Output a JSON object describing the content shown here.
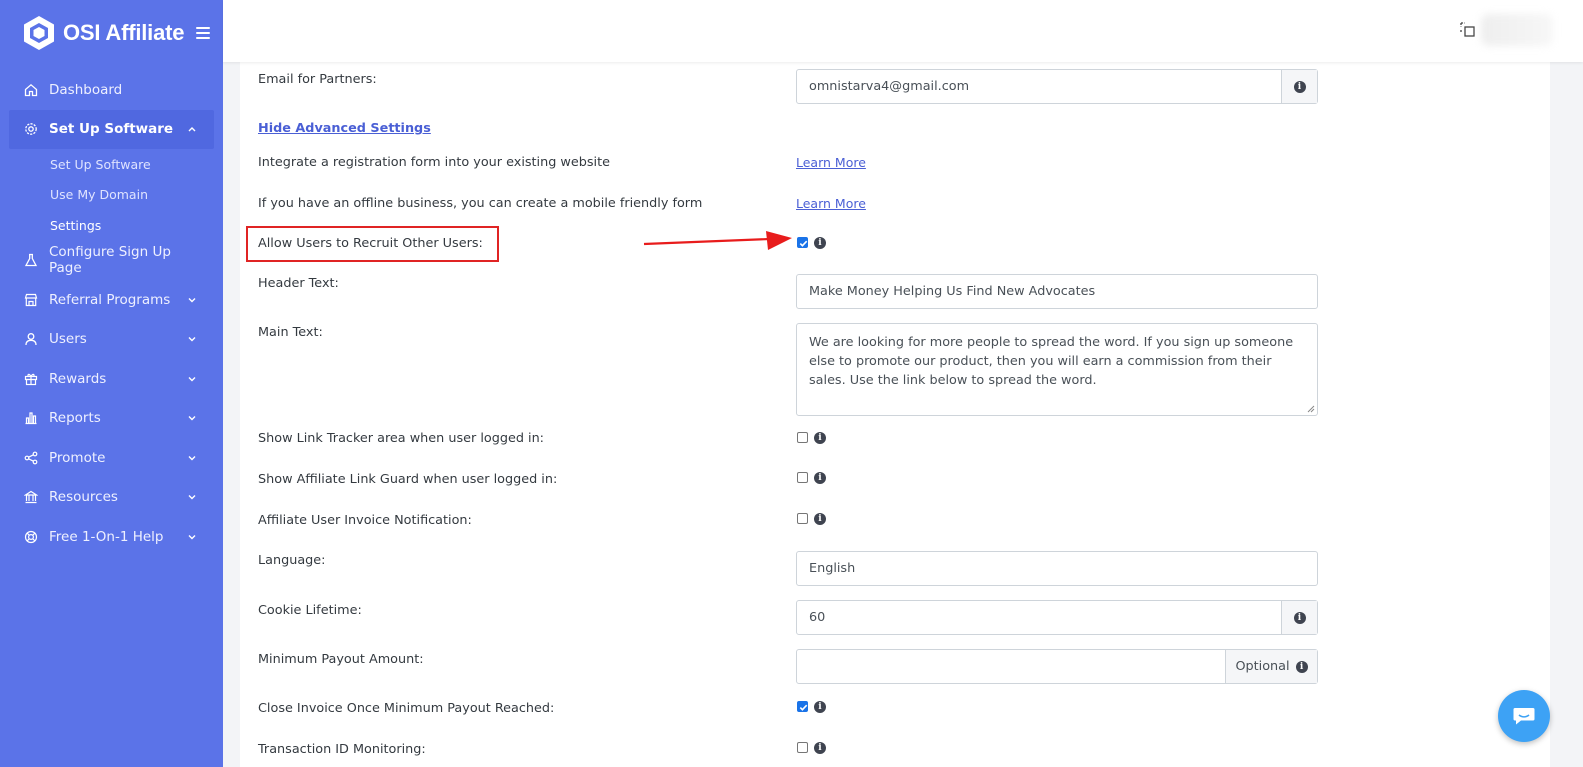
{
  "brand": {
    "name": "OSI Affiliate"
  },
  "sidebar": {
    "items": [
      {
        "label": "Dashboard",
        "icon": "home-icon"
      },
      {
        "label": "Set Up Software",
        "icon": "gear-icon",
        "expanded": true,
        "children": [
          {
            "label": "Set Up Software"
          },
          {
            "label": "Use My Domain"
          },
          {
            "label": "Settings"
          }
        ]
      },
      {
        "label": "Configure Sign Up Page",
        "icon": "flask-icon"
      },
      {
        "label": "Referral Programs",
        "icon": "store-icon"
      },
      {
        "label": "Users",
        "icon": "user-icon"
      },
      {
        "label": "Rewards",
        "icon": "gift-icon"
      },
      {
        "label": "Reports",
        "icon": "bar-chart-icon"
      },
      {
        "label": "Promote",
        "icon": "share-icon"
      },
      {
        "label": "Resources",
        "icon": "bank-icon"
      },
      {
        "label": "Free 1-On-1 Help",
        "icon": "lifebuoy-icon"
      }
    ]
  },
  "settings": {
    "email_label": "Email for Partners:",
    "email_value": "omnistarva4@gmail.com",
    "advanced_link": "Hide Advanced Settings",
    "integrate_text": "Integrate a registration form into your existing website",
    "offline_text": "If you have an offline business, you can create a mobile friendly form",
    "learn_more": "Learn More",
    "recruit_label": "Allow Users to Recruit Other Users:",
    "recruit_checked": true,
    "header_label": "Header Text:",
    "header_value": "Make Money Helping Us Find New Advocates",
    "main_label": "Main Text:",
    "main_value": "We are looking for more people to spread the word. If you sign up someone else to promote our product, then you will earn a commission from their sales. Use the link below to spread the word.",
    "link_tracker_label": "Show Link Tracker area when user logged in:",
    "link_tracker_checked": false,
    "link_guard_label": "Show Affiliate Link Guard when user logged in:",
    "link_guard_checked": false,
    "invoice_notif_label": "Affiliate User Invoice Notification:",
    "invoice_notif_checked": false,
    "language_label": "Language:",
    "language_value": "English",
    "cookie_label": "Cookie Lifetime:",
    "cookie_value": "60",
    "min_payout_label": "Minimum Payout Amount:",
    "min_payout_value": "",
    "optional_label": "Optional",
    "close_invoice_label": "Close Invoice Once Minimum Payout Reached:",
    "close_invoice_checked": true,
    "transaction_label": "Transaction ID Monitoring:",
    "transaction_checked": false
  },
  "colors": {
    "sidebar": "#5b73e8",
    "accent": "#4a5fd5",
    "highlight": "#e02424",
    "chat": "#3da2f5"
  }
}
